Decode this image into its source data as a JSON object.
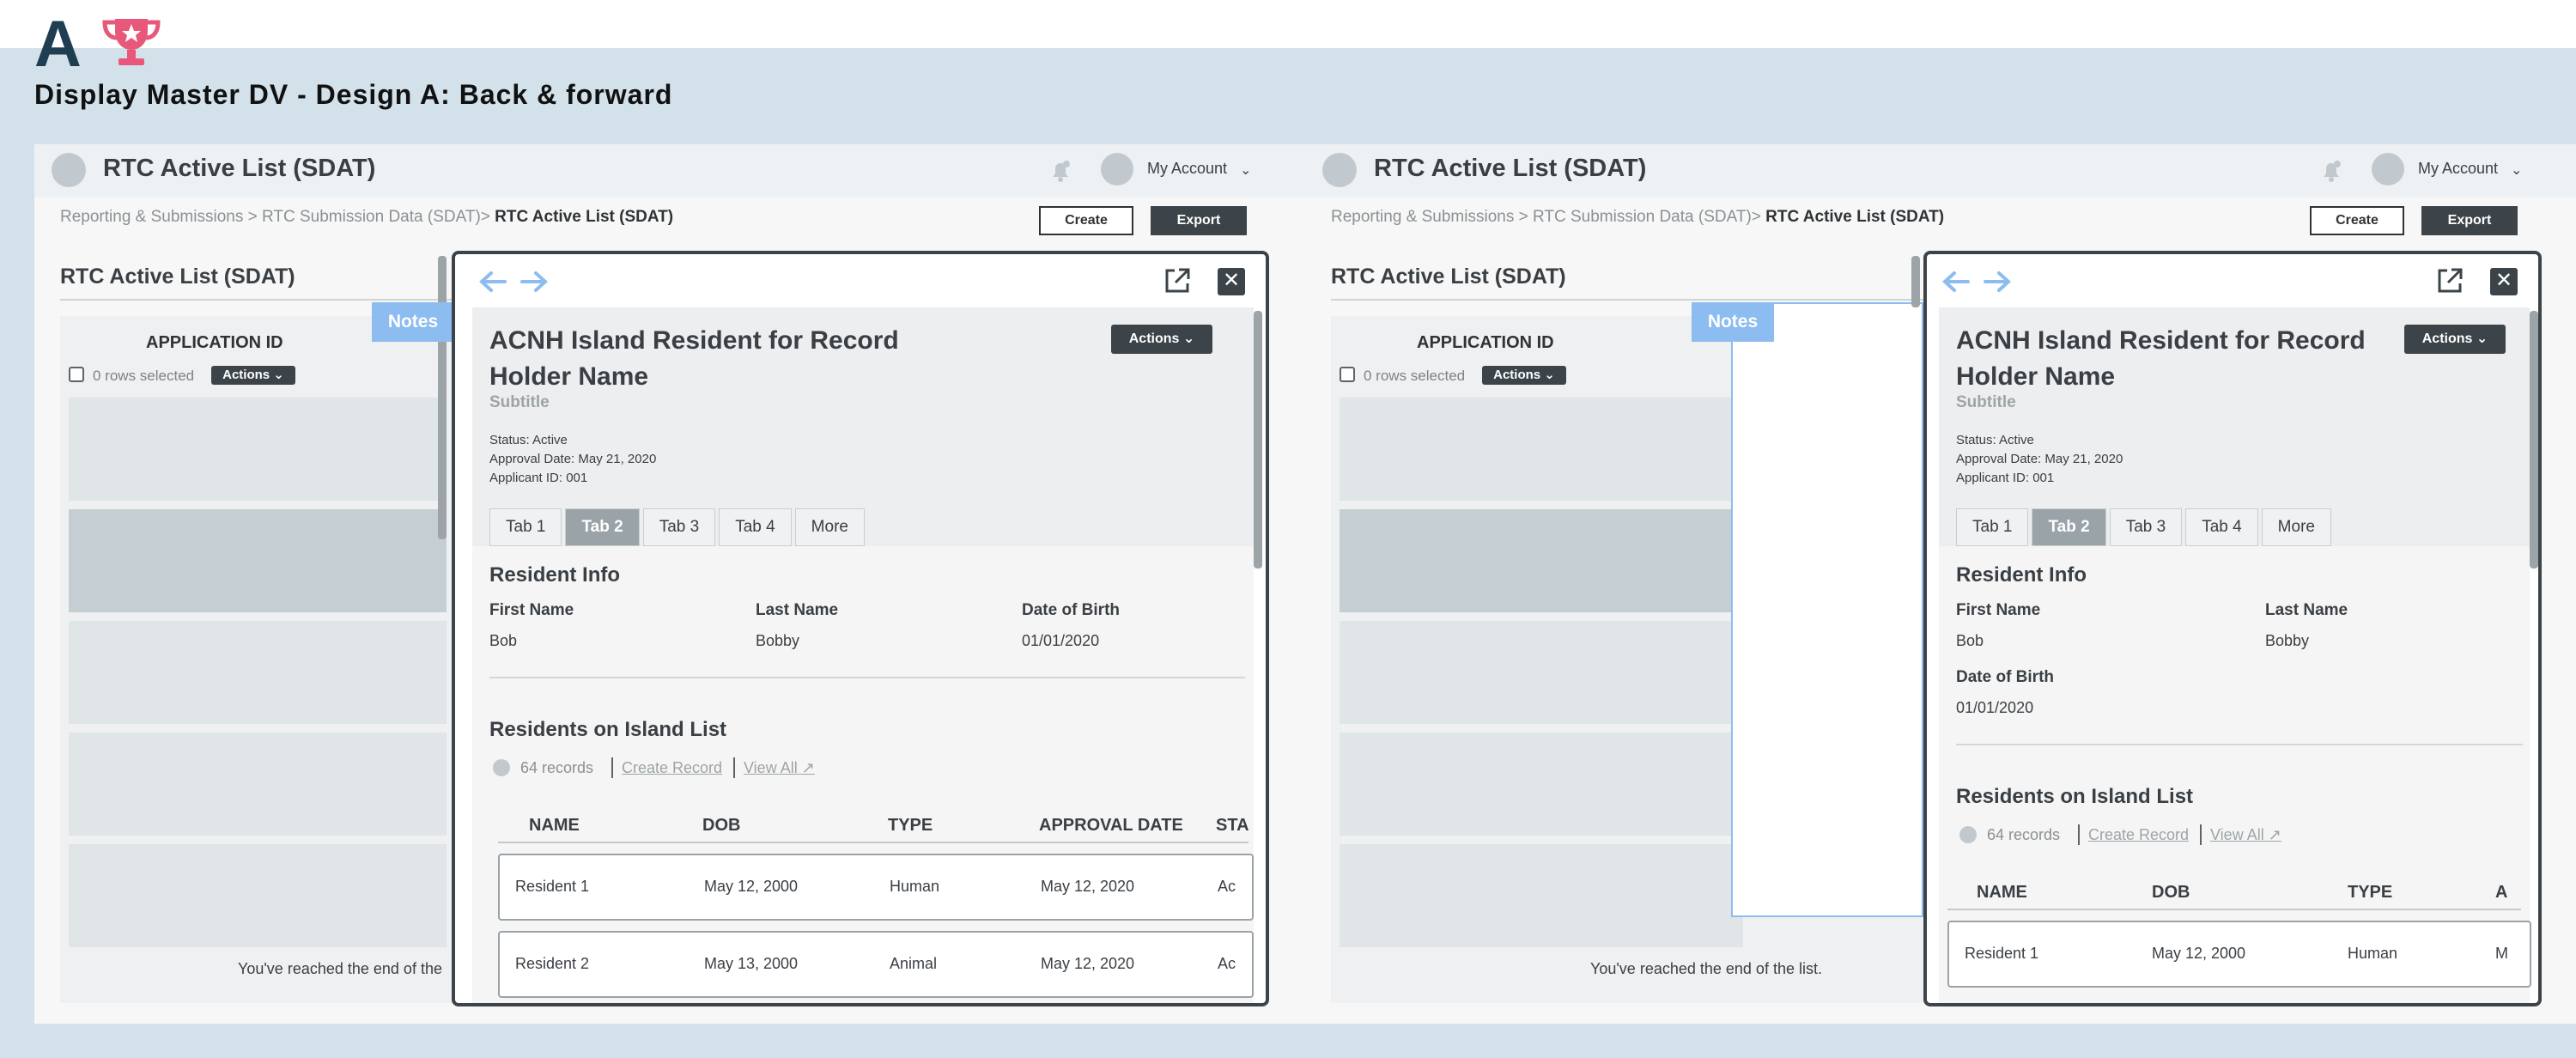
{
  "header": {
    "logo_letter": "A",
    "page_title": "Display Master DV - Design A: Back & forward"
  },
  "app": {
    "title": "RTC Active List (SDAT)",
    "account_label": "My Account",
    "breadcrumb": {
      "path": "Reporting & Submissions > RTC Submission Data (SDAT)>",
      "current": "RTC Active List (SDAT)"
    },
    "create_label": "Create",
    "export_label": "Export"
  },
  "list": {
    "title": "RTC Active List (SDAT)",
    "column_header": "APPLICATION ID",
    "rows_selected": "0 rows selected",
    "actions_label": "Actions",
    "end_text_truncated": "You've reached the end of the",
    "end_text_full": "You've reached the end of the list.",
    "notes_label": "Notes"
  },
  "record": {
    "title": "ACNH Island Resident for Record Holder Name",
    "subtitle": "Subtitle",
    "status": "Status: Active",
    "approval_date": "Approval Date: May 21, 2020",
    "applicant_id": "Applicant ID: 001",
    "actions_label": "Actions",
    "tabs": [
      "Tab 1",
      "Tab 2",
      "Tab 3",
      "Tab 4",
      "More"
    ],
    "selected_tab": "Tab 2"
  },
  "resident_info": {
    "heading": "Resident Info",
    "first_name_label": "First Name",
    "first_name": "Bob",
    "last_name_label": "Last Name",
    "last_name": "Bobby",
    "dob_label": "Date of Birth",
    "dob": "01/01/2020"
  },
  "residents_list": {
    "heading": "Residents on Island List",
    "records": "64 records",
    "create_record": "Create Record",
    "view_all": "View All",
    "columns": [
      "NAME",
      "DOB",
      "TYPE",
      "APPROVAL DATE",
      "STA"
    ],
    "columns_right": [
      "NAME",
      "DOB",
      "TYPE",
      "A"
    ],
    "rows": [
      {
        "name": "Resident 1",
        "dob": "May 12, 2000",
        "type": "Human",
        "approval": "May 12, 2020",
        "status": "Ac",
        "status_right": "M"
      },
      {
        "name": "Resident 2",
        "dob": "May 13, 2000",
        "type": "Animal",
        "approval": "May 12, 2020",
        "status": "Ac"
      }
    ]
  },
  "colors": {
    "background": "#d3e1ea",
    "dark": "#3d4449",
    "accent_blue": "#8cbcf0",
    "trophy": "#e8587a"
  },
  "icons": [
    "trophy-icon",
    "bell-icon",
    "chevron-down-icon",
    "arrow-left-icon",
    "arrow-right-icon",
    "external-link-icon",
    "close-icon",
    "caret-right-icon",
    "caret-left-icon"
  ]
}
